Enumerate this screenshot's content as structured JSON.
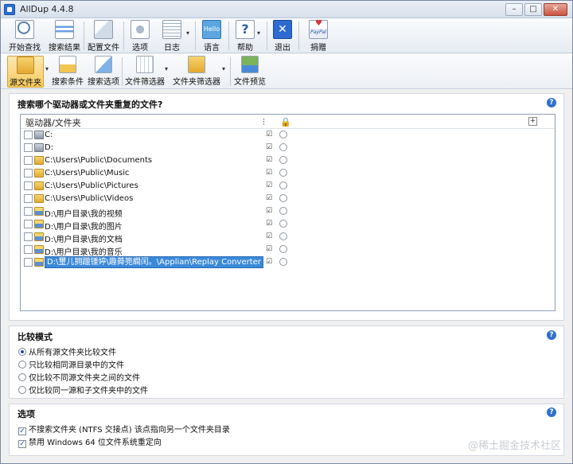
{
  "window": {
    "title": "AllDup 4.4.8"
  },
  "toolbar1": {
    "start_search": "开始查找",
    "search_results": "搜索结果",
    "config_file": "配置文件",
    "options": "选项",
    "log": "日志",
    "language": "语言",
    "language_icon_text": "Hello",
    "help": "帮助",
    "exit": "退出",
    "exit_icon": "✕",
    "donate": "捐赠"
  },
  "toolbar2": {
    "source_folder": "源文件夹",
    "search_conditions": "搜索条件",
    "search_options": "搜索选项",
    "file_filter": "文件筛选器",
    "folder_filter": "文件夹筛选器",
    "file_preview": "文件预览"
  },
  "source": {
    "title": "搜索哪个驱动器或文件夹重复的文件?",
    "column_header": "驱动器/文件夹",
    "rows": [
      {
        "path": "C:",
        "icon": "drive"
      },
      {
        "path": "D:",
        "icon": "drive"
      },
      {
        "path": "C:\\Users\\Public\\Documents",
        "icon": "folder"
      },
      {
        "path": "C:\\Users\\Public\\Music",
        "icon": "folder"
      },
      {
        "path": "C:\\Users\\Public\\Pictures",
        "icon": "folder"
      },
      {
        "path": "C:\\Users\\Public\\Videos",
        "icon": "folder"
      },
      {
        "path": "D:\\用户目录\\我的视频",
        "icon": "media"
      },
      {
        "path": "D:\\用户目录\\我的图片",
        "icon": "media"
      },
      {
        "path": "D:\\用户目录\\我的文档",
        "icon": "media"
      },
      {
        "path": "D:\\用户目录\\我的音乐",
        "icon": "media"
      },
      {
        "path": "D:\\璽儿拥躐锺婷\\趣蕣篼繝闰。\\Applian\\Replay Converter",
        "icon": "media",
        "selected": true
      }
    ]
  },
  "compare": {
    "title": "比较模式",
    "options": [
      "从所有源文件夹比较文件",
      "只比较相同源目录中的文件",
      "仅比较不同源文件夹之间的文件",
      "仅比较同一源和子文件夹中的文件"
    ],
    "selected_index": 0
  },
  "options": {
    "title": "选项",
    "items": [
      "不搜索文件夹 (NTFS 交接点) 该点指向另一个文件夹目录",
      "禁用 Windows 64 位文件系统重定向"
    ]
  },
  "watermark": "@稀土掘金技术社区"
}
